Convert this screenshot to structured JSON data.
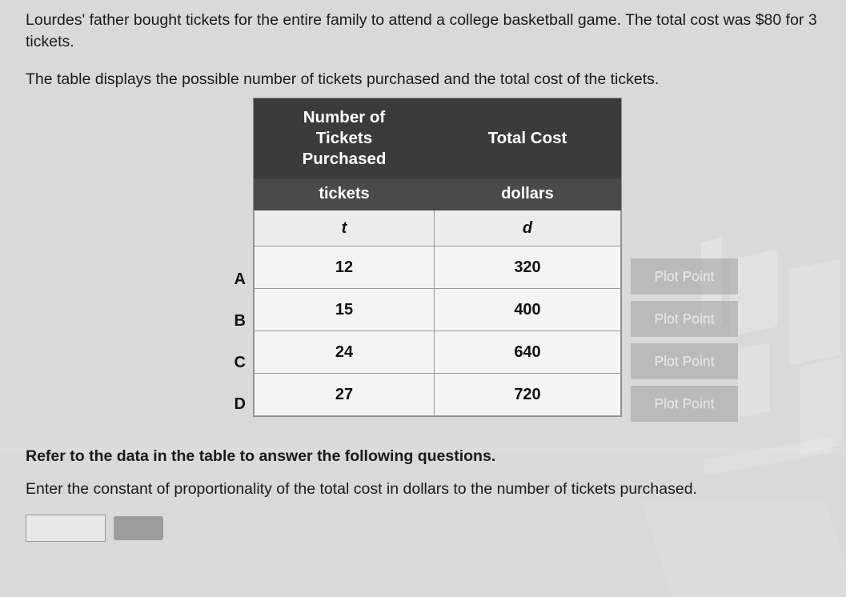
{
  "problem": {
    "intro": "Lourdes' father bought tickets for the entire family to attend a college basketball game. The total cost was $80 for 3 tickets.",
    "table_caption": "The table displays the possible number of tickets purchased and the total cost of the tickets.",
    "refer_line": "Refer to the data in the table to answer the following questions.",
    "question": "Enter the constant of proportionality of the total cost in dollars to the number of tickets purchased."
  },
  "table": {
    "headers": [
      "Number of Tickets Purchased",
      "Total Cost"
    ],
    "header_line1": "Number of",
    "header_line2": "Tickets",
    "header_line3": "Purchased",
    "header_col2": "Total Cost",
    "units": [
      "tickets",
      "dollars"
    ],
    "variables": [
      "t",
      "d"
    ],
    "rows": [
      {
        "label": "A",
        "tickets": "12",
        "cost": "320"
      },
      {
        "label": "B",
        "tickets": "15",
        "cost": "400"
      },
      {
        "label": "C",
        "tickets": "24",
        "cost": "640"
      },
      {
        "label": "D",
        "tickets": "27",
        "cost": "720"
      }
    ]
  },
  "buttons": {
    "plot_point_label": "Plot Point"
  },
  "answer": {
    "value": "",
    "placeholder": ""
  },
  "colors": {
    "header_bg": "#3b3b3b",
    "units_bg": "#4a4a4a",
    "table_bg": "#f4f4f4",
    "button_bg": "#a0a0a0",
    "page_bg": "#d9d9d9"
  }
}
